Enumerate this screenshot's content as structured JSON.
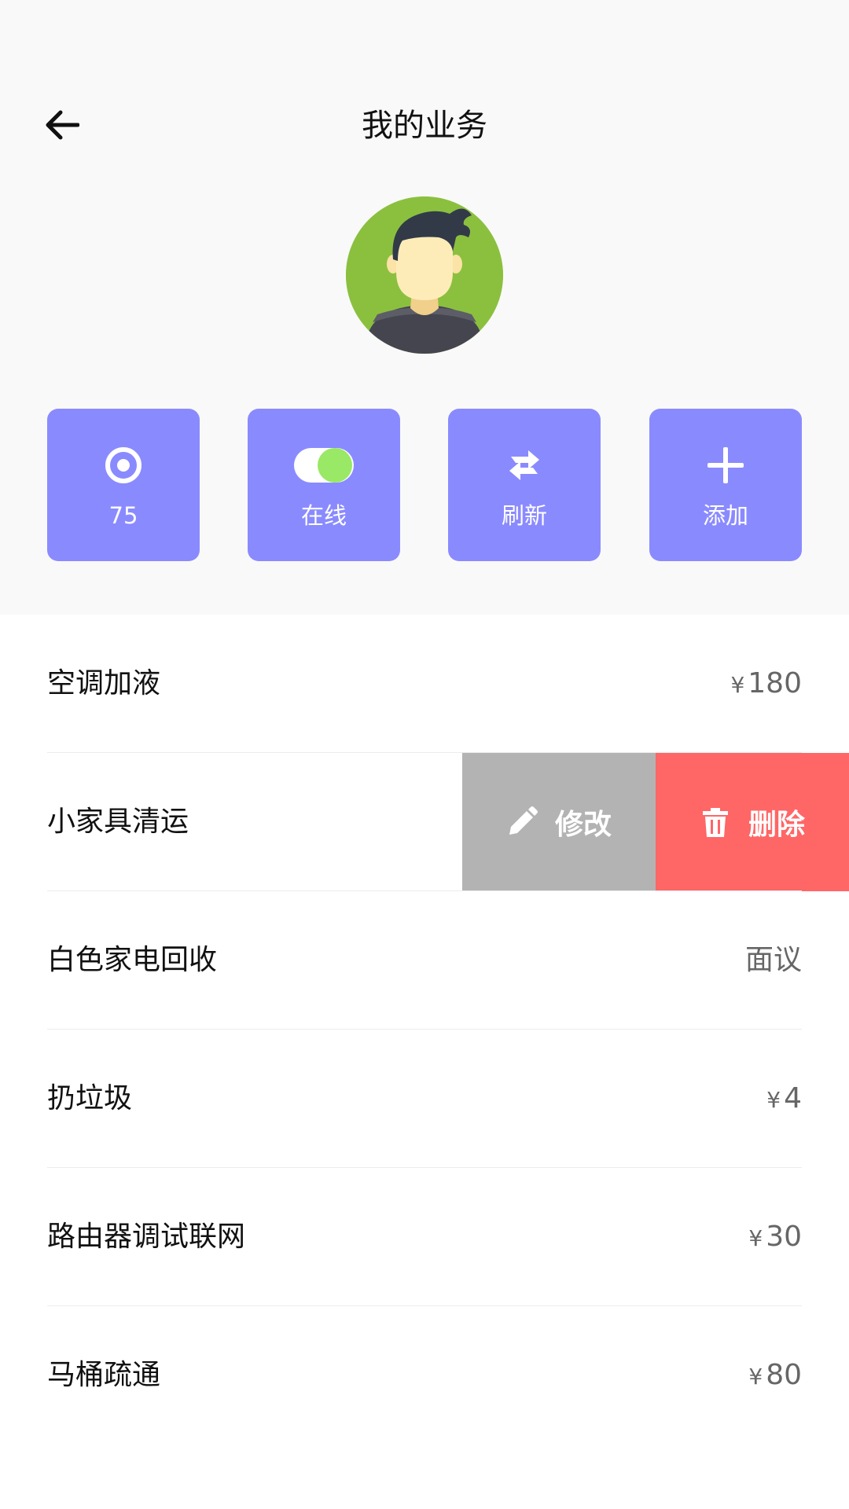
{
  "header": {
    "title": "我的业务",
    "back_icon": "arrow-left-icon",
    "avatar_icon": "user-avatar"
  },
  "actions": [
    {
      "icon": "target-icon",
      "label": "75"
    },
    {
      "icon": "toggle-switch-icon",
      "label": "在线"
    },
    {
      "icon": "refresh-icon",
      "label": "刷新"
    },
    {
      "icon": "plus-icon",
      "label": "添加"
    }
  ],
  "colors": {
    "accent": "#8a8aff",
    "toggle_on": "#99e866",
    "edit_bg": "#b3b3b3",
    "delete_bg": "#ff6666",
    "avatar_bg": "#8bc03f"
  },
  "services": [
    {
      "name": "空调加液",
      "currency": "¥",
      "price": "180"
    },
    {
      "name": "小家具清运",
      "swipe_actions": {
        "edit_label": "修改",
        "delete_label": "删除"
      }
    },
    {
      "name": "白色家电回收",
      "currency": "",
      "price": "面议"
    },
    {
      "name": "扔垃圾",
      "currency": "¥",
      "price": "4"
    },
    {
      "name": "路由器调试联网",
      "currency": "¥",
      "price": "30"
    },
    {
      "name": "马桶疏通",
      "currency": "¥",
      "price": "80"
    }
  ]
}
